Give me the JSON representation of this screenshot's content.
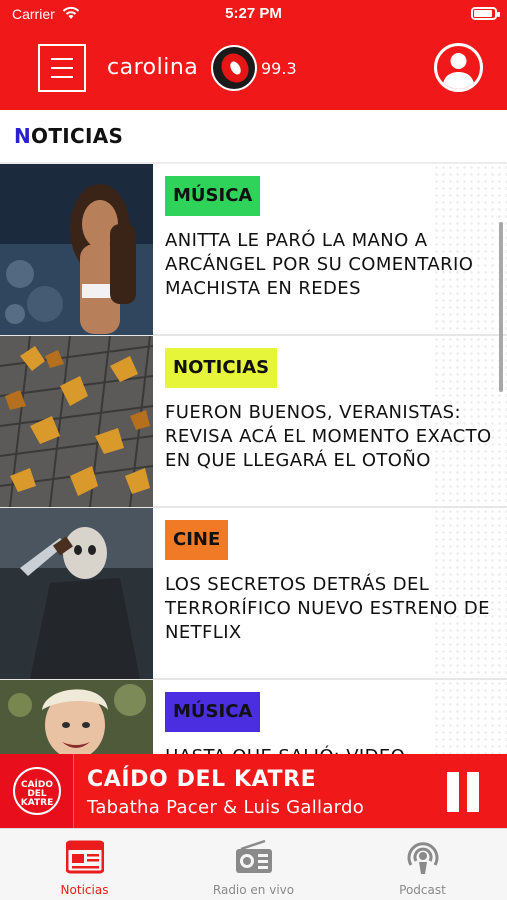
{
  "status_bar": {
    "carrier": "Carrier",
    "time": "5:27 PM",
    "battery_level": 0.9
  },
  "header": {
    "logo_text": "carolina",
    "logo_frequency": "99.3"
  },
  "section": {
    "title_first": "N",
    "title_rest": "OTICIAS"
  },
  "news": [
    {
      "category": "MÚSICA",
      "category_color": "#2fd35a",
      "headline": "ANITTA LE PARÓ LA MANO A ARCÁNGEL POR SU COMENTARIO MACHISTA EN REDES"
    },
    {
      "category": "NOTICIAS",
      "category_color": "#e6f53a",
      "headline": "FUERON BUENOS, VERANISTAS: REVISA ACÁ EL MOMENTO EXACTO EN QUE LLEGARÁ EL OTOÑO"
    },
    {
      "category": "CINE",
      "category_color": "#f07a26",
      "headline": "LOS SECRETOS DETRÁS DEL TERRORÍFICO NUEVO ESTRENO DE NETFLIX"
    },
    {
      "category": "MÚSICA",
      "category_color": "#4a2ee0",
      "headline": "HASTA QUE SALIÓ: VIDEO"
    }
  ],
  "player": {
    "art_text": "CAÍDO DEL KATRE",
    "title": "CAÍDO DEL KATRE",
    "artist": "Tabatha Pacer & Luis Gallardo"
  },
  "tabs": [
    {
      "label": "Noticias",
      "icon": "newspaper-icon",
      "active": true
    },
    {
      "label": "Radio en vivo",
      "icon": "radio-icon",
      "active": false
    },
    {
      "label": "Podcast",
      "icon": "podcast-icon",
      "active": false
    }
  ],
  "colors": {
    "brand_red": "#f01818",
    "title_accent": "#2b1fd6",
    "tab_active": "#ea1c1c",
    "tab_inactive": "#8a8a8a"
  }
}
